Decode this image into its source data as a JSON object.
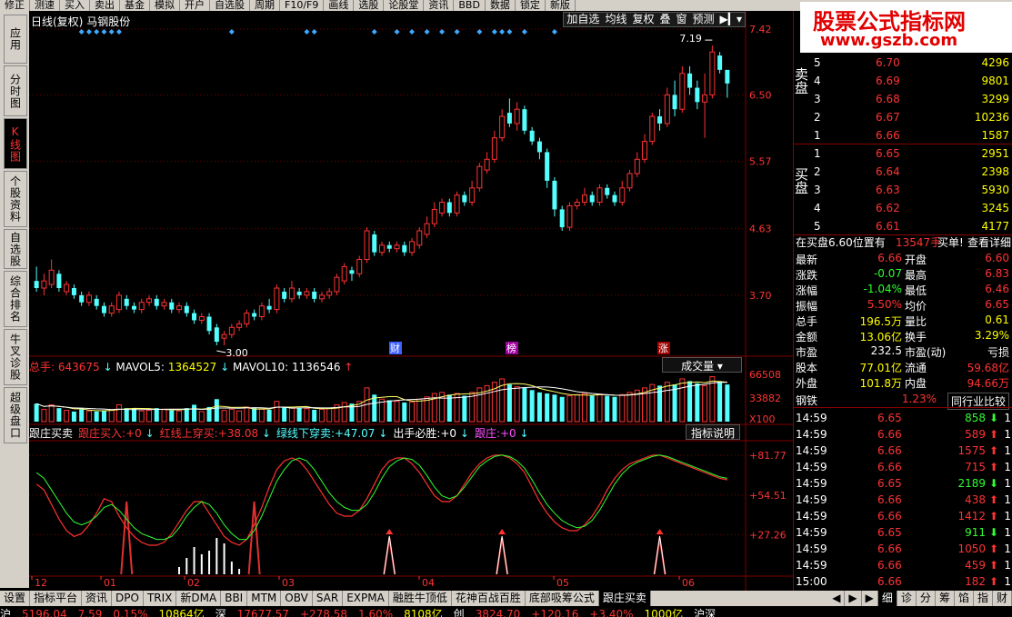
{
  "menubar": [
    "修正",
    "测速",
    "买入",
    "卖出",
    "基金",
    "模拟",
    "开户",
    "自选股",
    "周期",
    "F10/F9",
    "画线",
    "选股",
    "论股堂",
    "资讯",
    "BBD",
    "数据",
    "锁定",
    "新版"
  ],
  "left_tabs": [
    {
      "label": "应用"
    },
    {
      "label": "分时图"
    },
    {
      "label": "K线图",
      "active": true
    },
    {
      "label": "个股资料"
    },
    {
      "label": "自选股"
    },
    {
      "label": "综合排名"
    },
    {
      "label": "牛叉诊股"
    },
    {
      "label": "超级盘口"
    }
  ],
  "chart": {
    "title": "日线(复权)",
    "stock_name": "马钢股份",
    "toolbar": [
      "加自选",
      "均线",
      "复权",
      "叠",
      "窗",
      "预测"
    ],
    "price_axis": [
      "7.42",
      "6.50",
      "5.57",
      "4.63",
      "3.70"
    ],
    "high_label": "7.19",
    "low_label": "3.00",
    "event_markers": [
      "财",
      "榜",
      "涨"
    ],
    "volume": {
      "label": "总手",
      "value": "643675",
      "mavol5_label": "MAVOL5:",
      "mavol5": "1364527",
      "mavol10_label": "MAVOL10:",
      "mavol10": "1136546",
      "button": "成交量",
      "axis": [
        "66508",
        "33882"
      ],
      "unit": "X100"
    },
    "indicator": {
      "name": "跟庄买卖",
      "items": [
        {
          "label": "跟庄买入:",
          "value": "+0"
        },
        {
          "label": "红线上穿买:",
          "value": "+38.08"
        },
        {
          "label": "绿线下穿卖:",
          "value": "+47.07"
        },
        {
          "label": "出手必胜:",
          "value": "+0"
        },
        {
          "label": "跟庄:",
          "value": "+0"
        }
      ],
      "button": "指标说明",
      "axis": [
        "+81.77",
        "+54.51",
        "+27.26"
      ]
    },
    "months": [
      "12",
      "01",
      "02",
      "03",
      "04",
      "05",
      "06"
    ]
  },
  "chart_data": {
    "type": "candlestick",
    "price_ticks": [
      7.42,
      6.5,
      5.57,
      4.63,
      3.7
    ],
    "high": 7.19,
    "low": 3.0,
    "candles": [
      [
        3.9,
        3.8,
        4.1,
        3.75
      ],
      [
        3.8,
        3.9,
        4.0,
        3.7
      ],
      [
        3.85,
        4.05,
        4.2,
        3.8
      ],
      [
        4.0,
        3.8,
        4.05,
        3.75
      ],
      [
        3.75,
        3.85,
        3.9,
        3.7
      ],
      [
        3.8,
        3.7,
        3.85,
        3.65
      ],
      [
        3.7,
        3.6,
        3.75,
        3.55
      ],
      [
        3.6,
        3.7,
        3.75,
        3.55
      ],
      [
        3.65,
        3.55,
        3.7,
        3.5
      ],
      [
        3.55,
        3.45,
        3.6,
        3.4
      ],
      [
        3.45,
        3.55,
        3.6,
        3.4
      ],
      [
        3.5,
        3.7,
        3.75,
        3.45
      ],
      [
        3.65,
        3.55,
        3.7,
        3.5
      ],
      [
        3.55,
        3.5,
        3.6,
        3.45
      ],
      [
        3.5,
        3.6,
        3.65,
        3.45
      ],
      [
        3.6,
        3.65,
        3.7,
        3.55
      ],
      [
        3.65,
        3.55,
        3.7,
        3.5
      ],
      [
        3.55,
        3.6,
        3.65,
        3.5
      ],
      [
        3.6,
        3.5,
        3.65,
        3.45
      ],
      [
        3.5,
        3.55,
        3.6,
        3.45
      ],
      [
        3.55,
        3.45,
        3.6,
        3.4
      ],
      [
        3.45,
        3.35,
        3.5,
        3.3
      ],
      [
        3.35,
        3.4,
        3.45,
        3.3
      ],
      [
        3.4,
        3.2,
        3.45,
        3.15
      ],
      [
        3.25,
        3.05,
        3.3,
        3.0
      ],
      [
        3.1,
        3.15,
        3.2,
        3.0
      ],
      [
        3.15,
        3.25,
        3.3,
        3.1
      ],
      [
        3.25,
        3.3,
        3.35,
        3.2
      ],
      [
        3.3,
        3.45,
        3.5,
        3.25
      ],
      [
        3.45,
        3.4,
        3.5,
        3.35
      ],
      [
        3.4,
        3.55,
        3.6,
        3.35
      ],
      [
        3.55,
        3.5,
        3.65,
        3.45
      ],
      [
        3.5,
        3.8,
        3.85,
        3.45
      ],
      [
        3.75,
        3.65,
        3.8,
        3.6
      ],
      [
        3.65,
        3.8,
        3.9,
        3.6
      ],
      [
        3.75,
        3.7,
        3.8,
        3.65
      ],
      [
        3.7,
        3.75,
        3.8,
        3.65
      ],
      [
        3.75,
        3.65,
        3.8,
        3.6
      ],
      [
        3.65,
        3.7,
        3.75,
        3.6
      ],
      [
        3.7,
        3.75,
        3.8,
        3.65
      ],
      [
        3.75,
        3.95,
        4.0,
        3.7
      ],
      [
        3.9,
        4.1,
        4.15,
        3.85
      ],
      [
        4.05,
        4.0,
        4.1,
        3.9
      ],
      [
        4.0,
        4.2,
        4.25,
        3.95
      ],
      [
        4.2,
        4.6,
        4.65,
        4.15
      ],
      [
        4.55,
        4.3,
        4.6,
        4.25
      ],
      [
        4.3,
        4.4,
        4.45,
        4.25
      ],
      [
        4.4,
        4.35,
        4.45,
        4.3
      ],
      [
        4.35,
        4.4,
        4.45,
        4.3
      ],
      [
        4.4,
        4.3,
        4.45,
        4.25
      ],
      [
        4.3,
        4.45,
        4.5,
        4.25
      ],
      [
        4.4,
        4.6,
        4.65,
        4.35
      ],
      [
        4.55,
        4.7,
        4.8,
        4.5
      ],
      [
        4.7,
        4.9,
        5.0,
        4.65
      ],
      [
        4.85,
        5.0,
        5.05,
        4.8
      ],
      [
        5.0,
        4.85,
        5.05,
        4.8
      ],
      [
        4.85,
        5.1,
        5.15,
        4.8
      ],
      [
        5.1,
        5.0,
        5.15,
        4.95
      ],
      [
        5.0,
        5.2,
        5.3,
        4.95
      ],
      [
        5.2,
        5.5,
        5.55,
        5.15
      ],
      [
        5.45,
        5.6,
        5.7,
        5.4
      ],
      [
        5.6,
        5.9,
        6.0,
        5.55
      ],
      [
        5.9,
        6.2,
        6.3,
        5.85
      ],
      [
        6.25,
        6.1,
        6.45,
        6.05
      ],
      [
        6.1,
        6.3,
        6.4,
        6.0
      ],
      [
        6.3,
        6.0,
        6.35,
        5.95
      ],
      [
        6.0,
        5.85,
        6.05,
        5.8
      ],
      [
        5.85,
        5.7,
        5.9,
        5.6
      ],
      [
        5.7,
        5.3,
        5.75,
        5.2
      ],
      [
        5.3,
        4.9,
        5.35,
        4.8
      ],
      [
        4.9,
        4.65,
        4.95,
        4.6
      ],
      [
        4.65,
        4.95,
        5.0,
        4.6
      ],
      [
        4.95,
        5.0,
        5.05,
        4.9
      ],
      [
        5.0,
        5.1,
        5.2,
        4.95
      ],
      [
        5.1,
        5.0,
        5.15,
        4.95
      ],
      [
        5.0,
        5.2,
        5.25,
        4.95
      ],
      [
        5.2,
        5.1,
        5.25,
        5.05
      ],
      [
        5.1,
        5.0,
        5.15,
        4.95
      ],
      [
        5.0,
        5.2,
        5.3,
        4.95
      ],
      [
        5.2,
        5.4,
        5.45,
        5.15
      ],
      [
        5.4,
        5.6,
        5.7,
        5.35
      ],
      [
        5.6,
        5.85,
        5.95,
        5.55
      ],
      [
        5.85,
        6.2,
        6.25,
        5.8
      ],
      [
        6.2,
        6.1,
        6.3,
        6.0
      ],
      [
        6.1,
        6.5,
        6.6,
        6.05
      ],
      [
        6.5,
        6.3,
        6.7,
        6.2
      ],
      [
        6.3,
        6.8,
        6.9,
        6.25
      ],
      [
        6.8,
        6.6,
        6.9,
        6.5
      ],
      [
        6.6,
        6.4,
        6.7,
        6.3
      ],
      [
        6.4,
        6.5,
        6.8,
        5.9
      ],
      [
        6.5,
        7.1,
        7.19,
        6.45
      ],
      [
        7.05,
        6.85,
        7.1,
        6.8
      ],
      [
        6.85,
        6.66,
        6.83,
        6.46
      ]
    ],
    "volume": [
      160,
      110,
      150,
      120,
      100,
      90,
      110,
      95,
      90,
      100,
      105,
      150,
      120,
      115,
      95,
      100,
      120,
      110,
      100,
      95,
      120,
      150,
      90,
      130,
      200,
      100,
      110,
      95,
      130,
      120,
      110,
      105,
      180,
      130,
      120,
      125,
      115,
      105,
      110,
      120,
      150,
      170,
      160,
      180,
      300,
      240,
      200,
      190,
      180,
      170,
      175,
      200,
      220,
      250,
      260,
      240,
      250,
      230,
      260,
      300,
      320,
      350,
      380,
      330,
      310,
      300,
      280,
      260,
      250,
      240,
      220,
      230,
      240,
      250,
      230,
      245,
      230,
      220,
      240,
      260,
      280,
      300,
      330,
      320,
      350,
      330,
      380,
      360,
      340,
      320,
      400,
      360,
      330
    ],
    "indicator_red": [
      62,
      58,
      48,
      38,
      30,
      26,
      28,
      34,
      42,
      52,
      50,
      40,
      32,
      26,
      22,
      20,
      20,
      22,
      28,
      36,
      44,
      50,
      50,
      42,
      34,
      26,
      22,
      20,
      24,
      34,
      46,
      60,
      72,
      78,
      80,
      78,
      72,
      64,
      56,
      48,
      42,
      40,
      40,
      44,
      52,
      62,
      72,
      78,
      80,
      80,
      76,
      70,
      62,
      54,
      50,
      50,
      54,
      62,
      70,
      76,
      80,
      82,
      82,
      80,
      76,
      70,
      60,
      50,
      42,
      36,
      32,
      30,
      30,
      34,
      40,
      48,
      58,
      66,
      72,
      76,
      78,
      80,
      82,
      82,
      80,
      78,
      76,
      74,
      72,
      70,
      68,
      66,
      65
    ],
    "indicator_green": [
      70,
      66,
      58,
      50,
      42,
      36,
      34,
      36,
      40,
      46,
      48,
      44,
      38,
      32,
      28,
      26,
      24,
      24,
      26,
      32,
      40,
      46,
      50,
      48,
      42,
      34,
      28,
      24,
      24,
      30,
      40,
      52,
      64,
      72,
      78,
      80,
      78,
      72,
      64,
      56,
      50,
      46,
      44,
      44,
      48,
      56,
      66,
      74,
      78,
      80,
      79,
      75,
      68,
      60,
      54,
      52,
      54,
      60,
      67,
      74,
      78,
      81,
      82,
      81,
      78,
      73,
      65,
      56,
      48,
      42,
      37,
      34,
      32,
      33,
      37,
      44,
      53,
      62,
      69,
      74,
      77,
      79,
      81,
      82,
      81,
      79,
      77,
      75,
      73,
      71,
      69,
      67,
      66
    ],
    "indicator_spikes": [
      12,
      29,
      47,
      62,
      83
    ],
    "indicator_arrows": [
      47,
      62,
      83
    ],
    "xlabel": "",
    "ylabel": ""
  },
  "quote": {
    "sell_label": "卖盘",
    "buy_label": "买盘",
    "sell": [
      {
        "level": "5",
        "price": "6.70",
        "vol": "4296"
      },
      {
        "level": "4",
        "price": "6.69",
        "vol": "9801"
      },
      {
        "level": "3",
        "price": "6.68",
        "vol": "3299"
      },
      {
        "level": "2",
        "price": "6.67",
        "vol": "10236"
      },
      {
        "level": "1",
        "price": "6.66",
        "vol": "1587"
      }
    ],
    "buy": [
      {
        "level": "1",
        "price": "6.65",
        "vol": "2951"
      },
      {
        "level": "2",
        "price": "6.64",
        "vol": "2398"
      },
      {
        "level": "3",
        "price": "6.63",
        "vol": "5930"
      },
      {
        "level": "4",
        "price": "6.62",
        "vol": "3245"
      },
      {
        "level": "5",
        "price": "6.61",
        "vol": "4177"
      }
    ],
    "notice": "在买盘6.60位置有",
    "notice_vol": "13547手",
    "notice_action": "买单!",
    "notice_link": "查看详细",
    "stats": [
      {
        "l1": "最新",
        "v1": "6.66",
        "l2": "开盘",
        "v2": "6.60"
      },
      {
        "l1": "涨跌",
        "v1": "-0.07",
        "l2": "最高",
        "v2": "6.83"
      },
      {
        "l1": "涨幅",
        "v1": "-1.04%",
        "l2": "最低",
        "v2": "6.46"
      },
      {
        "l1": "振幅",
        "v1": "5.50%",
        "l2": "均价",
        "v2": "6.65"
      },
      {
        "l1": "总手",
        "v1": "196.5万",
        "l2": "量比",
        "v2": "0.61"
      },
      {
        "l1": "金额",
        "v1": "13.06亿",
        "l2": "换手",
        "v2": "3.29%"
      },
      {
        "l1": "市盈",
        "v1": "232.5",
        "l2": "市盈(动)",
        "v2": "亏损"
      },
      {
        "l1": "股本",
        "v1": "77.01亿",
        "l2": "流通",
        "v2": "59.68亿"
      },
      {
        "l1": "外盘",
        "v1": "101.8万",
        "l2": "内盘",
        "v2": "94.66万"
      }
    ],
    "industry": "钢铁",
    "industry_pct": "1.23%",
    "industry_btn": "同行业比较",
    "ticks": [
      {
        "t": "14:59",
        "p": "6.65",
        "v": "858",
        "d": "down",
        "n": "1"
      },
      {
        "t": "14:59",
        "p": "6.66",
        "v": "589",
        "d": "up",
        "n": "1"
      },
      {
        "t": "14:59",
        "p": "6.66",
        "v": "1575",
        "d": "up",
        "n": "1"
      },
      {
        "t": "14:59",
        "p": "6.66",
        "v": "715",
        "d": "up",
        "n": "1"
      },
      {
        "t": "14:59",
        "p": "6.65",
        "v": "2189",
        "d": "down",
        "n": "1"
      },
      {
        "t": "14:59",
        "p": "6.66",
        "v": "438",
        "d": "up",
        "n": "1"
      },
      {
        "t": "14:59",
        "p": "6.66",
        "v": "1412",
        "d": "up",
        "n": "1"
      },
      {
        "t": "14:59",
        "p": "6.65",
        "v": "911",
        "d": "down",
        "n": "1"
      },
      {
        "t": "14:59",
        "p": "6.66",
        "v": "1050",
        "d": "up",
        "n": "1"
      },
      {
        "t": "14:59",
        "p": "6.66",
        "v": "459",
        "d": "up",
        "n": "1"
      },
      {
        "t": "15:00",
        "p": "6.66",
        "v": "182",
        "d": "up",
        "n": "1"
      }
    ]
  },
  "bottom_tabs": [
    {
      "label": "设置"
    },
    {
      "label": "指标平台"
    },
    {
      "label": "资讯"
    },
    {
      "label": "DPO"
    },
    {
      "label": "TRIX"
    },
    {
      "label": "新DMA"
    },
    {
      "label": "BBI"
    },
    {
      "label": "MTM"
    },
    {
      "label": "OBV"
    },
    {
      "label": "SAR"
    },
    {
      "label": "EXPMA"
    },
    {
      "label": "融胜牛顶低"
    },
    {
      "label": "花神百战百胜"
    },
    {
      "label": "底部吸筹公式"
    },
    {
      "label": "跟庄买卖",
      "active": true
    }
  ],
  "right_bottom_tabs": [
    "细",
    "诊",
    "分",
    "筹",
    "馅",
    "指",
    "财"
  ],
  "status": [
    {
      "text": "沪",
      "c": "#fff"
    },
    {
      "text": "5196.04",
      "c": "#f33"
    },
    {
      "text": "7.59",
      "c": "#f33"
    },
    {
      "text": "0.15%",
      "c": "#f33"
    },
    {
      "text": "10864亿",
      "c": "#ff0"
    },
    {
      "text": "深",
      "c": "#fff"
    },
    {
      "text": "17677.57",
      "c": "#f33"
    },
    {
      "text": "+278.58",
      "c": "#f33"
    },
    {
      "text": "1.60%",
      "c": "#f33"
    },
    {
      "text": "8108亿",
      "c": "#ff0"
    },
    {
      "text": "创",
      "c": "#fff"
    },
    {
      "text": "3824.70",
      "c": "#f33"
    },
    {
      "text": "+120.16",
      "c": "#f33"
    },
    {
      "text": "+3.40%",
      "c": "#f33"
    },
    {
      "text": "1000亿",
      "c": "#ff0"
    },
    {
      "text": "沪深",
      "c": "#fff"
    }
  ],
  "watermark": {
    "line1": "股票公式指标网",
    "line2": "www.gszb.com"
  },
  "colors": {
    "up": "#ff3232",
    "down": "#54ffff",
    "frame": "#800000",
    "yellow": "#ffff00",
    "magenta": "#ff50ff"
  }
}
